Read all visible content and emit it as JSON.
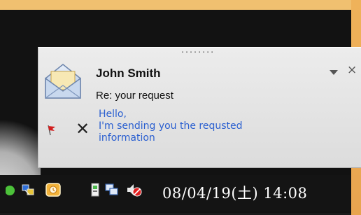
{
  "notification": {
    "sender": "John Smith",
    "subject": "Re: your request",
    "preview_lines": [
      "Hello,",
      "I'm sending you the requsted",
      "information"
    ],
    "grip": "........",
    "close_glyph": "×",
    "delete_glyph": "✕"
  },
  "tray": {
    "clock": "08/04/19(土) 14:08",
    "icons": [
      "app-icon",
      "network-device-icon",
      "outlook-reminder-icon",
      "safely-remove-hardware-icon",
      "network-connections-icon",
      "volume-muted-icon"
    ]
  },
  "colors": {
    "preview_text": "#2a5fd0",
    "toast_bg": "#e4e4e4",
    "flag": "#d21f1f",
    "taskbar": "#141414"
  }
}
